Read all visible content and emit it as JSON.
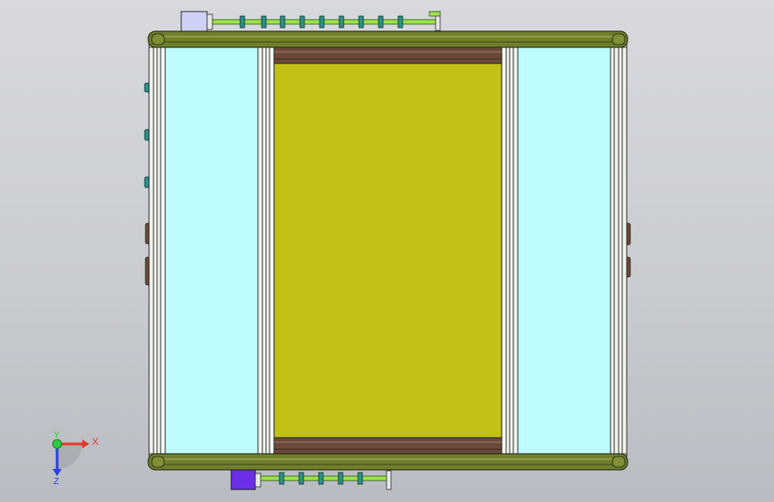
{
  "viewport": {
    "background_top": "#d7d9dd",
    "background_bottom": "#b9bcc2"
  },
  "model": {
    "rail_color": "#6f7f2c",
    "rail_highlight": "#9aa64a",
    "glass_color": "#bffcfc",
    "center_panel_color": "#c1c116",
    "beam_color": "#6b4a3b",
    "post_color": "#eef0ea",
    "motor_top_color": "#cfd0f5",
    "motor_bottom_color": "#6a2fe6",
    "shaft_color": "#9be447",
    "roller_color": "#2f8e86"
  },
  "triad": {
    "x_label": "X",
    "y_label": "Y",
    "z_label": "Z",
    "x_color": "#e23a2a",
    "y_color": "#2ecc40",
    "z_color": "#2f3fe0"
  }
}
